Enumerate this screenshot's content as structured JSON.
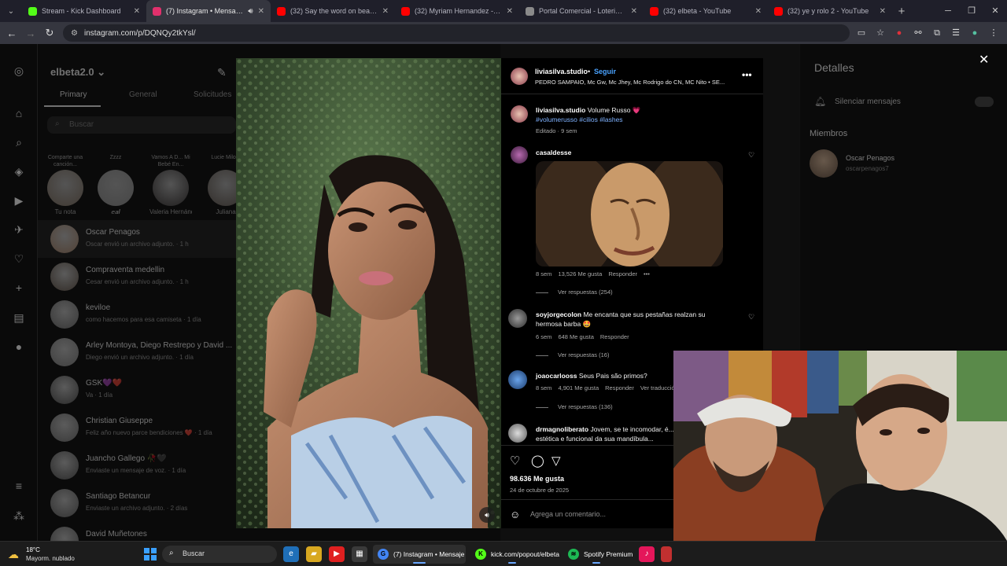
{
  "browser": {
    "tabs": [
      {
        "title": "Stream - Kick Dashboard",
        "favicon_color": "#53fc18",
        "active": false,
        "audio": false
      },
      {
        "title": "(7) Instagram • Mensajes",
        "favicon_color": "#e1306c",
        "active": true,
        "audio": true
      },
      {
        "title": "(32) Say the word on beat. (Lev",
        "favicon_color": "#ff0000",
        "active": false,
        "audio": false
      },
      {
        "title": "(32) Myriam Hernandez - Herid",
        "favicon_color": "#ff0000",
        "active": false,
        "audio": false
      },
      {
        "title": "Portal Comercial - Loteria de M",
        "favicon_color": "#8a8a8a",
        "active": false,
        "audio": false
      },
      {
        "title": "(32) elbeta - YouTube",
        "favicon_color": "#ff0000",
        "active": false,
        "audio": false
      },
      {
        "title": "(32) ye y rolo 2 - YouTube",
        "favicon_color": "#ff0000",
        "active": false,
        "audio": false
      }
    ],
    "url": "instagram.com/p/DQNQy2tkYsl/"
  },
  "dm": {
    "account": "elbeta2.0",
    "tabs": [
      "Primary",
      "General",
      "Solicitudes"
    ],
    "search_placeholder": "Buscar",
    "notes": [
      {
        "caption": "Comparte una canción...",
        "name": "Tu nota",
        "color": "#8a7a6a"
      },
      {
        "caption": "Zzzz",
        "name": "𝒆𝒂𝒍",
        "color": "#9a9a9a"
      },
      {
        "caption": "Vamos A D... Mi Bebé En...",
        "name": "Valeria Hernánd...",
        "color": "#3c3838"
      },
      {
        "caption": "Lucie Milo I.",
        "name": "Juliana",
        "color": "#6a6058"
      }
    ],
    "chats": [
      {
        "name": "Oscar Penagos",
        "preview": "Oscar envió un archivo adjunto. · 1 h",
        "color": "#b48e72",
        "selected": true
      },
      {
        "name": "Compraventa medellin",
        "preview": "Cesar envió un archivo adjunto. · 1 h",
        "color": "#6a5c50",
        "selected": false
      },
      {
        "name": "keviloe",
        "preview": "como hacemos para esa camiseta · 1 día",
        "color": "#777777",
        "selected": false
      },
      {
        "name": "Arley Montoya, Diego Restrepo y David ...",
        "preview": "Diego envió un archivo adjunto. · 1 día",
        "color": "#8a8a8a",
        "selected": false
      },
      {
        "name": "GSK💜❤️",
        "preview": "Va · 1 día",
        "color": "#555555",
        "selected": false
      },
      {
        "name": "Christian Giuseppe",
        "preview": "Feliz año nuevo parce bendiciones ❤️ · 1 día",
        "color": "#7a7a7a",
        "selected": false
      },
      {
        "name": "Juancho Gallego 🥀🖤",
        "preview": "Enviaste un mensaje de voz. · 1 día",
        "color": "#5a5a5a",
        "selected": false
      },
      {
        "name": "Santiago Betancur",
        "preview": "Enviaste un archivo adjunto. · 2 días",
        "color": "#6a6a6a",
        "selected": false
      },
      {
        "name": "David Muñetones",
        "preview": "",
        "color": "#6a6a6a",
        "selected": false
      }
    ]
  },
  "details": {
    "title": "Detalles",
    "mute_label": "Silenciar mensajes",
    "members_label": "Miembros",
    "member_name": "Oscar Penagos",
    "member_user": "oscarpenagos7"
  },
  "post": {
    "author": "liviasilva.studio",
    "follow_label": "Seguir",
    "audio": "PEDRO SAMPAIO, Mc Gw, Mc Jhey, Mc Rodrigo do CN, MC Nito • SE...",
    "caption_user": "liviasilva.studio",
    "caption_text": "Volume Russo 💗",
    "caption_tags": "#volumerusso #cilios #lashes",
    "caption_meta": "Editado · 9 sem",
    "comments": [
      {
        "user": "casaldesse",
        "text": "",
        "has_image": true,
        "time": "8 sem",
        "likes": "13,526 Me gusta",
        "reply": "Responder",
        "more": "•••",
        "replies": "Ver respuestas (254)"
      },
      {
        "user": "soyjorgecolon",
        "text": "Me encanta que sus pestañas realzan su hermosa barba 🤩",
        "time": "6 sem",
        "likes": "648 Me gusta",
        "reply": "Responder",
        "replies": "Ver respuestas (16)"
      },
      {
        "user": "joaocarlooss",
        "text": "Seus Pais são primos?",
        "time": "8 sem",
        "likes": "4,901 Me gusta",
        "reply": "Responder",
        "translate": "Ver traducción",
        "replies": "Ver respuestas (136)"
      },
      {
        "user": "drmagnoliberato",
        "text": "Jovem, se te incomodar, é... parte estética e funcional da sua mandíbula...",
        "time": "",
        "likes": "",
        "reply": "",
        "replies": ""
      }
    ],
    "total_likes": "98.636 Me gusta",
    "date": "24 de octubre de 2025",
    "comment_placeholder": "Agrega un comentario..."
  },
  "taskbar": {
    "temp": "18°C",
    "weather": "Mayorm. nublado",
    "search": "Buscar",
    "apps": [
      {
        "label": "(7) Instagram • Mensaje",
        "color": "#4285f4"
      },
      {
        "label": "kick.com/popout/elbeta",
        "color": "#53fc18"
      },
      {
        "label": "Spotify Premium",
        "color": "#1db954"
      }
    ]
  }
}
